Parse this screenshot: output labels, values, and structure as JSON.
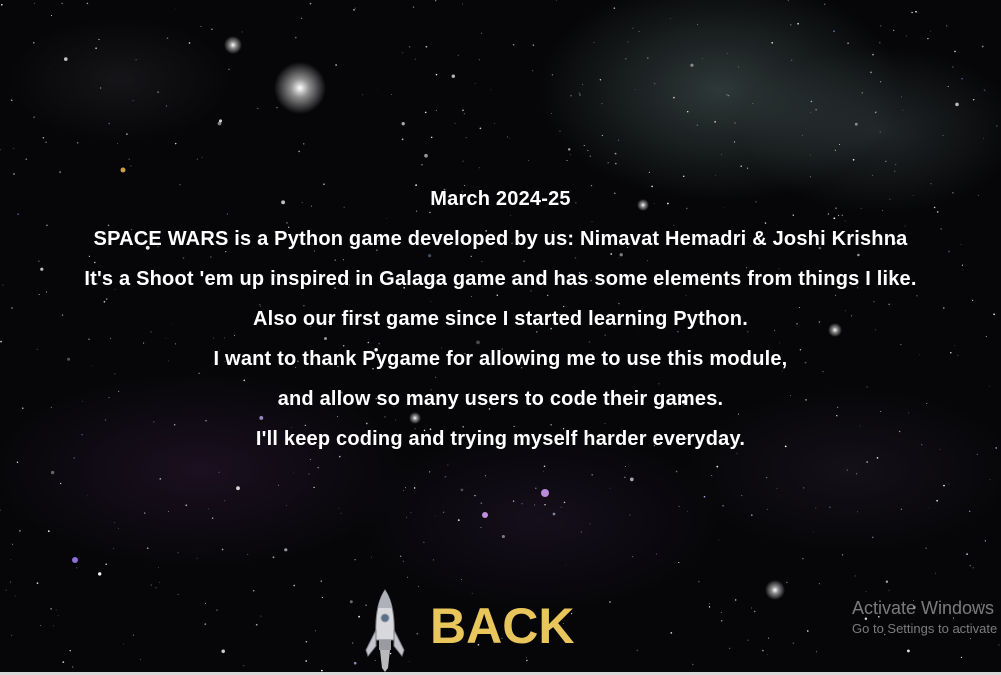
{
  "credits": {
    "lines": [
      "March 2024-25",
      "SPACE WARS is a Python game developed by us: Nimavat Hemadri & Joshi Krishna",
      "It's a Shoot 'em up inspired in Galaga game and has some elements from things I like.",
      "Also our first game since I started learning Python.",
      "I want to thank Pygame for allowing me to use this module,",
      "and allow so many users to code their games.",
      "I'll keep coding and trying myself harder everyday."
    ]
  },
  "back_button": {
    "label": "BACK",
    "color": "#e8c65b"
  },
  "decor": {
    "rocket_icon": "rocket-icon",
    "background": "starfield-nebula"
  },
  "watermark": {
    "title": "Activate Windows",
    "subtitle": "Go to Settings to activate Windows."
  }
}
